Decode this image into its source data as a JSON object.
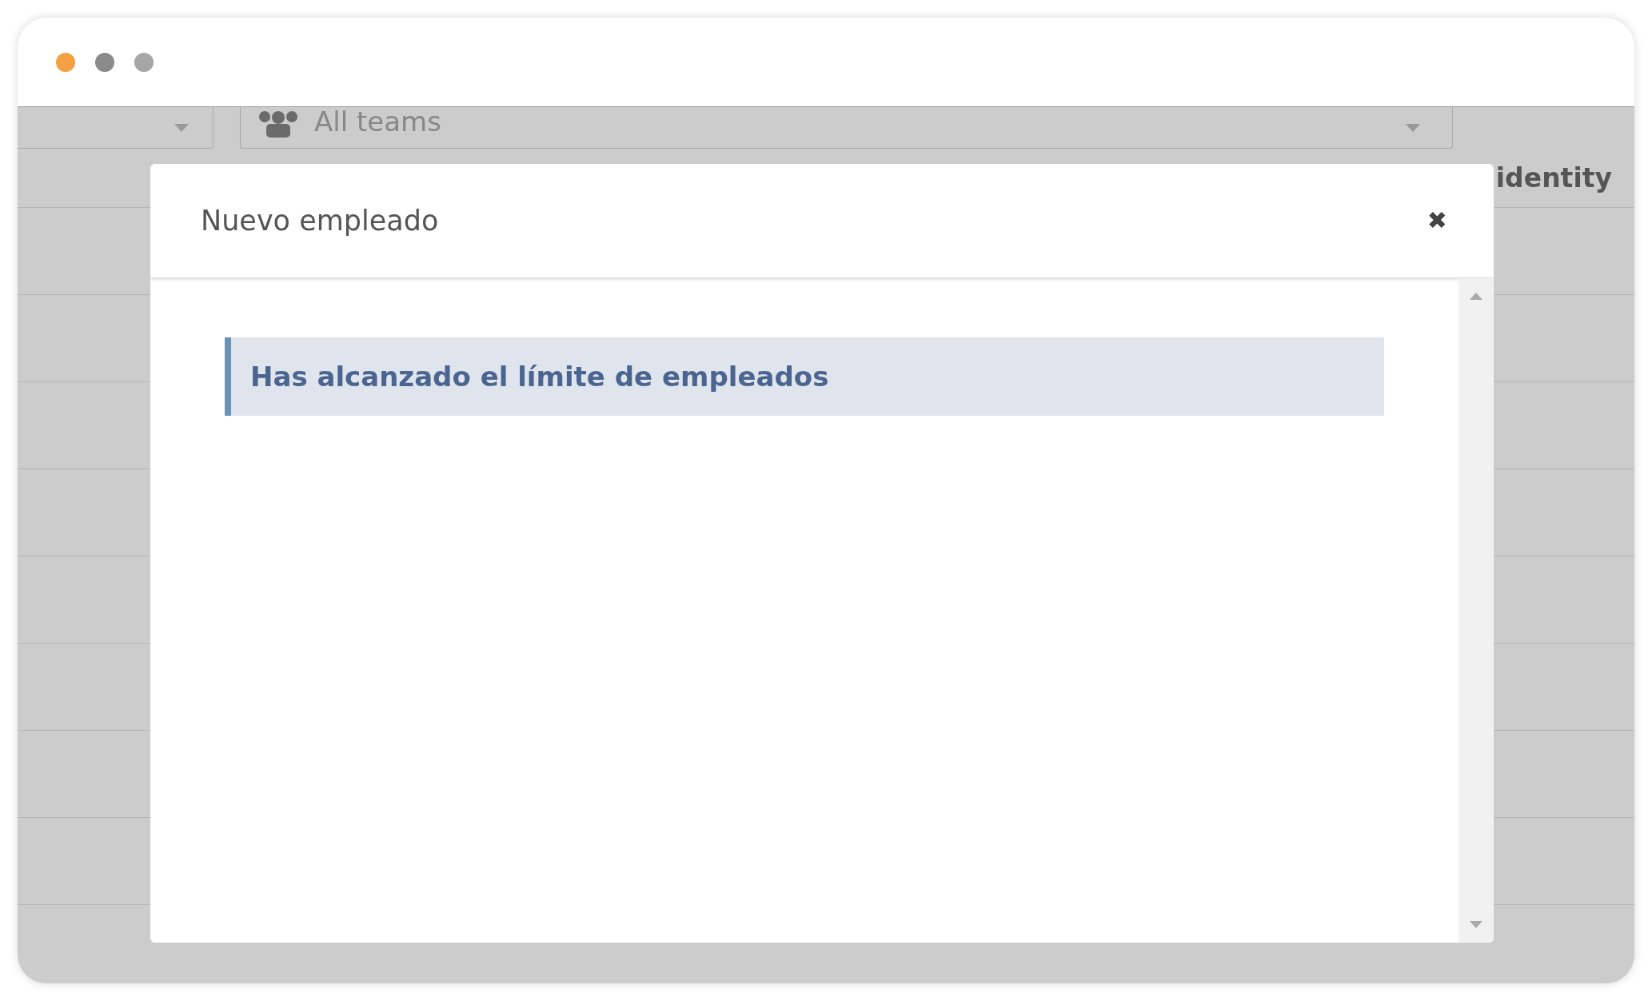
{
  "window": {
    "controls": [
      {
        "color": "#f59e42"
      },
      {
        "color": "#8a8a8a"
      },
      {
        "color": "#a6a6a6"
      }
    ]
  },
  "background": {
    "team_filter": {
      "value": "All teams"
    },
    "column_header": "identity"
  },
  "modal": {
    "title": "Nuevo empleado",
    "close": "✖",
    "alert": "Has alcanzado el límite de empleados"
  }
}
